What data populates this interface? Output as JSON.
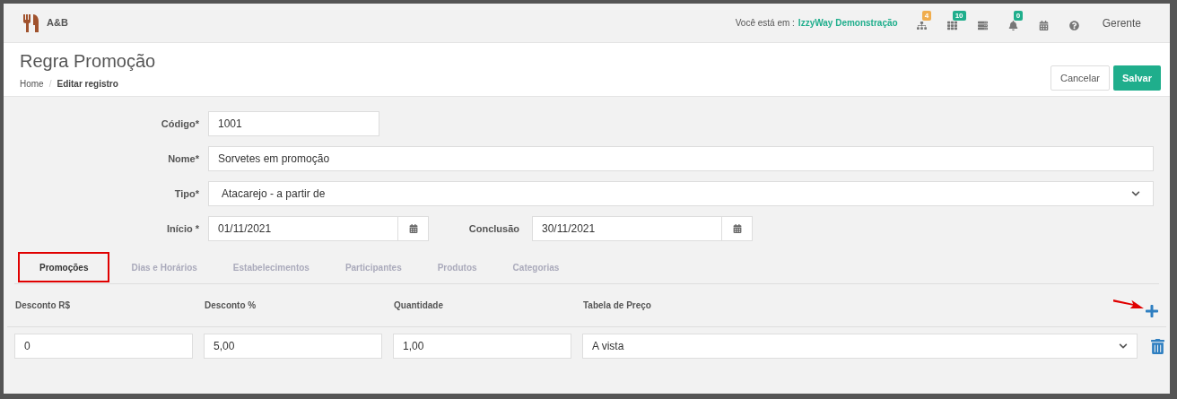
{
  "header": {
    "app_name": "A&B",
    "location_label": "Você está em :",
    "location": "IzzyWay Demonstração",
    "icons": [
      {
        "kind": "sitemap",
        "badge": "4",
        "color": "#f0ad4e"
      },
      {
        "kind": "grid",
        "badge": "10",
        "color": "#1fae8c"
      },
      {
        "kind": "list"
      },
      {
        "kind": "bell",
        "badge": "0",
        "color": "#1fae8c"
      },
      {
        "kind": "calendar"
      },
      {
        "kind": "help"
      }
    ],
    "user": "Gerente"
  },
  "page": {
    "title": "Regra Promoção",
    "breadcrumb": [
      "Home",
      "Editar registro"
    ],
    "breadcrumb_separator": "/",
    "buttons": [
      {
        "label": "Cancelar",
        "kind": "secondary"
      },
      {
        "label": "Salvar",
        "kind": "primary"
      }
    ]
  },
  "form": {
    "codigo": {
      "label": "Código*",
      "value": "1001"
    },
    "nome": {
      "label": "Nome*",
      "value": "Sorvetes em promoção"
    },
    "tipo": {
      "label": "Tipo*",
      "value": "Atacarejo - a partir de"
    },
    "inicio": {
      "label": "Início *",
      "value": "01/11/2021"
    },
    "conclusao": {
      "label": "Conclusão",
      "value": "30/11/2021"
    }
  },
  "tabs": [
    {
      "label": "Promoções",
      "selected": true
    },
    {
      "label": "Dias e Horários",
      "selected": false
    },
    {
      "label": "Estabelecimentos",
      "selected": false
    },
    {
      "label": "Participantes",
      "selected": false
    },
    {
      "label": "Produtos",
      "selected": false
    },
    {
      "label": "Categorias",
      "selected": false
    }
  ],
  "table": {
    "columns": [
      "Desconto R$",
      "Desconto %",
      "Quantidade",
      "Tabela de Preço"
    ],
    "rows": [
      {
        "desconto_rs": "0",
        "desconto_pct": "5,00",
        "quantidade": "1,00",
        "tabela": "A vista"
      }
    ]
  }
}
